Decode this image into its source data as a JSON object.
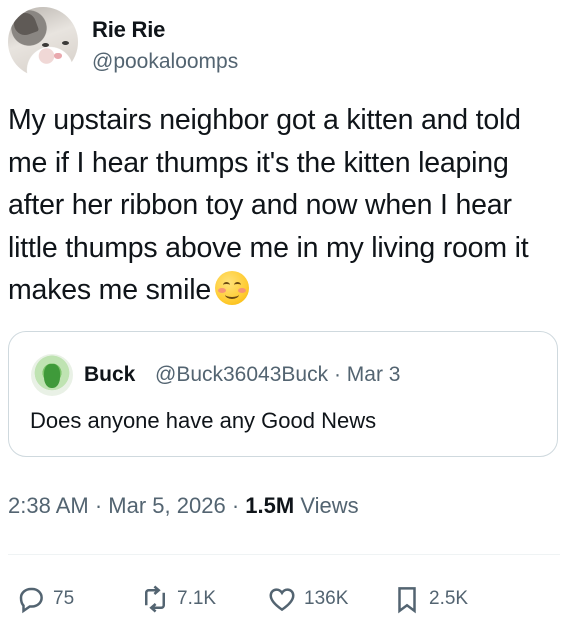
{
  "author": {
    "name": "Rie Rie",
    "handle": "@pookaloomps"
  },
  "tweet": {
    "text": "My upstairs neighbor got a kitten and told me if I hear thumps it's the kitten leaping after her ribbon toy and now when I hear little thumps above me in my living room it makes me smile",
    "emoji": "smiling-face-with-smiling-eyes"
  },
  "quoted_tweet": {
    "name": "Buck",
    "handle": "@Buck36043Buck",
    "separator": "·",
    "date": "Mar 3",
    "text": "Does anyone have any Good News"
  },
  "meta": {
    "time": "2:38 AM",
    "sep1": "·",
    "date": "Mar 5, 2026",
    "sep2": "·",
    "views_count": "1.5M",
    "views_label": "Views"
  },
  "actions": {
    "replies": "75",
    "reposts": "7.1K",
    "likes": "136K",
    "bookmarks": "2.5K"
  },
  "icons": {
    "reply": "speech-bubble-icon",
    "repost": "repost-arrows-icon",
    "like": "heart-icon",
    "bookmark": "bookmark-icon"
  },
  "colors": {
    "text": "#0f1419",
    "secondary": "#536471",
    "border": "#cfd9de"
  }
}
